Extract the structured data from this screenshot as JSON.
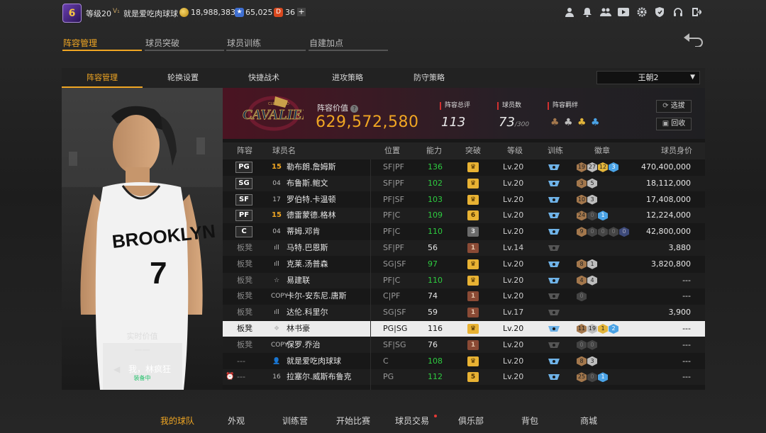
{
  "topbar": {
    "avatar_text": "6",
    "level": "等级20",
    "vip_icon": "vip-icon",
    "username": "就是爱吃肉球球",
    "gold": "18,988,383",
    "points": "65,025",
    "points_icon_text": "★",
    "tickets": "36",
    "tickets_icon_text": "D",
    "plus": "+",
    "icons": [
      "profile-icon",
      "bell-icon",
      "friends-icon",
      "video-icon",
      "settings-icon",
      "shield-icon",
      "headset-icon",
      "exit-icon"
    ]
  },
  "main_tabs": [
    {
      "label": "阵容管理",
      "active": true
    },
    {
      "label": "球员突破",
      "active": false
    },
    {
      "label": "球员训练",
      "active": false
    },
    {
      "label": "自建加点",
      "active": false
    }
  ],
  "sub_tabs": [
    {
      "label": "阵容管理",
      "active": true
    },
    {
      "label": "轮换设置",
      "active": false
    },
    {
      "label": "快捷战术",
      "active": false
    },
    {
      "label": "进攻策略",
      "active": false
    },
    {
      "label": "防守策略",
      "active": false
    }
  ],
  "dynasty_select": {
    "value": "王朝2",
    "caret": "▼"
  },
  "player_card": {
    "realtime_label": "实时价值",
    "realtime_value": "一一",
    "arrow": "◀",
    "name": "我，林疯狂",
    "status": "装备中"
  },
  "team_header": {
    "value_label": "阵容价值",
    "help": "?",
    "value": "629,572,580",
    "overall_label": "阵容总评",
    "overall": "113",
    "players_label": "球员数",
    "players": "73",
    "players_max": "/300",
    "chem_label": "阵容羁绊",
    "chem_icons": [
      "chem-bronze-icon",
      "chem-silver-icon",
      "chem-gold-icon",
      "chem-blue-icon"
    ],
    "btn_select": "选拔",
    "btn_recycle": "回收"
  },
  "table": {
    "headers": [
      "阵容",
      "球员名",
      "位置",
      "能力",
      "突破",
      "等级",
      "训练",
      "徽章",
      "球员身价"
    ],
    "rows": [
      {
        "slot": "PG",
        "starter": true,
        "num": "15",
        "num_gold": true,
        "name": "勒布朗.詹姆斯",
        "pos": "SF|PF",
        "rating": "136",
        "green": true,
        "brk": "♛",
        "brk_type": "gold",
        "lv": "Lv.20",
        "train": "blue",
        "badges": [
          [
            "bronze",
            "19"
          ],
          [
            "silver",
            "27"
          ],
          [
            "gold",
            "12"
          ],
          [
            "blue",
            "3"
          ]
        ],
        "value": "470,400,000"
      },
      {
        "slot": "SG",
        "starter": true,
        "num": "04",
        "num_gold": false,
        "name": "布鲁斯.鲍文",
        "pos": "SF|PF",
        "rating": "102",
        "green": true,
        "brk": "♛",
        "brk_type": "gold",
        "lv": "Lv.20",
        "train": "blue",
        "badges": [
          [
            "bronze",
            "3"
          ],
          [
            "silver",
            "5"
          ]
        ],
        "value": "18,112,000"
      },
      {
        "slot": "SF",
        "starter": true,
        "num": "17",
        "num_gold": false,
        "name": "罗伯特.卡温顿",
        "pos": "PF|SF",
        "rating": "103",
        "green": true,
        "brk": "♛",
        "brk_type": "gold",
        "lv": "Lv.20",
        "train": "blue",
        "badges": [
          [
            "bronze",
            "10"
          ],
          [
            "silver",
            "3"
          ]
        ],
        "value": "17,408,000"
      },
      {
        "slot": "PF",
        "starter": true,
        "num": "15",
        "num_gold": true,
        "name": "德雷蒙德.格林",
        "pos": "PF|C",
        "rating": "109",
        "green": true,
        "brk": "6",
        "brk_type": "gold",
        "lv": "Lv.20",
        "train": "blue",
        "badges": [
          [
            "bronze",
            "24"
          ],
          [
            "dim",
            "0"
          ],
          [
            "blue",
            "1"
          ]
        ],
        "value": "12,224,000"
      },
      {
        "slot": "C",
        "starter": true,
        "num": "04",
        "num_gold": false,
        "name": "蒂姆.邓肯",
        "pos": "PF|C",
        "rating": "110",
        "green": true,
        "brk": "3",
        "brk_type": "dark",
        "lv": "Lv.20",
        "train": "blue",
        "badges": [
          [
            "bronze",
            "9"
          ],
          [
            "dim",
            "0"
          ],
          [
            "dim",
            "0"
          ],
          [
            "dim",
            "0"
          ],
          [
            "navy",
            "0"
          ]
        ],
        "value": "42,800,000"
      },
      {
        "slot": "板凳",
        "starter": false,
        "num": "ıll",
        "num_gold": false,
        "name": "马特.巴恩斯",
        "pos": "SF|PF",
        "rating": "56",
        "green": false,
        "brk": "1",
        "brk_type": "brown",
        "lv": "Lv.14",
        "train": "dim",
        "badges": [],
        "value": "3,880"
      },
      {
        "slot": "板凳",
        "starter": false,
        "num": "ıll",
        "num_gold": false,
        "name": "克莱.汤普森",
        "pos": "SG|SF",
        "rating": "97",
        "green": true,
        "brk": "♛",
        "brk_type": "gold",
        "lv": "Lv.20",
        "train": "blue",
        "badges": [
          [
            "bronze",
            "8"
          ],
          [
            "silver",
            "1"
          ]
        ],
        "value": "3,820,800"
      },
      {
        "slot": "板凳",
        "starter": false,
        "num": "☆",
        "num_gold": false,
        "name": "易建联",
        "pos": "PF|C",
        "rating": "110",
        "green": true,
        "brk": "♛",
        "brk_type": "gold",
        "lv": "Lv.20",
        "train": "blue",
        "badges": [
          [
            "bronze",
            "4"
          ],
          [
            "silver",
            "4"
          ]
        ],
        "value": "---"
      },
      {
        "slot": "板凳",
        "starter": false,
        "num": "COPY",
        "num_gold": false,
        "name": "卡尔-安东尼.唐斯",
        "pos": "C|PF",
        "rating": "74",
        "green": false,
        "brk": "1",
        "brk_type": "brown",
        "lv": "Lv.20",
        "train": "dim",
        "badges": [
          [
            "dim",
            "0"
          ]
        ],
        "value": "---"
      },
      {
        "slot": "板凳",
        "starter": false,
        "num": "ıll",
        "num_gold": false,
        "name": "达伦.科里尔",
        "pos": "SG|SF",
        "rating": "59",
        "green": false,
        "brk": "1",
        "brk_type": "brown",
        "lv": "Lv.17",
        "train": "dim",
        "badges": [],
        "value": "3,900"
      },
      {
        "slot": "板凳",
        "starter": false,
        "selected": true,
        "num": "❖",
        "num_gold": false,
        "name": "林书豪",
        "pos": "PG|SG",
        "rating": "116",
        "green": false,
        "brk": "♛",
        "brk_type": "gold",
        "lv": "Lv.20",
        "train": "blue",
        "badges": [
          [
            "bronze",
            "11"
          ],
          [
            "silver",
            "19"
          ],
          [
            "gold",
            "1"
          ],
          [
            "blue",
            "2"
          ]
        ],
        "value": "---"
      },
      {
        "slot": "板凳",
        "starter": false,
        "num": "COPY",
        "num_gold": false,
        "name": "保罗.乔治",
        "pos": "SF|SG",
        "rating": "76",
        "green": false,
        "brk": "1",
        "brk_type": "brown",
        "lv": "Lv.20",
        "train": "dim",
        "badges": [
          [
            "dim",
            "0"
          ],
          [
            "dim",
            "0"
          ]
        ],
        "value": "---"
      },
      {
        "slot": "---",
        "starter": false,
        "num": "👤",
        "num_gold": false,
        "name": "就是爱吃肉球球",
        "pos": "C",
        "rating": "108",
        "green": true,
        "brk": "♛",
        "brk_type": "gold",
        "lv": "Lv.20",
        "train": "blue",
        "badges": [
          [
            "bronze",
            "8"
          ],
          [
            "silver",
            "3"
          ]
        ],
        "value": "---"
      },
      {
        "slot": "---",
        "starter": false,
        "clock": true,
        "num": "16",
        "num_gold": false,
        "name": "拉塞尔.威斯布鲁克",
        "pos": "PG",
        "rating": "112",
        "green": true,
        "brk": "5",
        "brk_type": "gold",
        "lv": "Lv.20",
        "train": "blue",
        "badges": [
          [
            "bronze",
            "25"
          ],
          [
            "dim",
            "0"
          ],
          [
            "blue",
            "1"
          ]
        ],
        "value": "---"
      }
    ]
  },
  "bottom_nav": [
    {
      "label": "我的球队",
      "active": true
    },
    {
      "label": "外观",
      "active": false
    },
    {
      "label": "训练营",
      "active": false
    },
    {
      "label": "开始比赛",
      "active": false
    },
    {
      "label": "球员交易",
      "active": false,
      "dot": true
    },
    {
      "label": "俱乐部",
      "active": false
    },
    {
      "label": "背包",
      "active": false
    },
    {
      "label": "商城",
      "active": false
    }
  ],
  "colors": {
    "accent": "#f0a623",
    "green": "#2ecc40",
    "red": "#d13030"
  }
}
